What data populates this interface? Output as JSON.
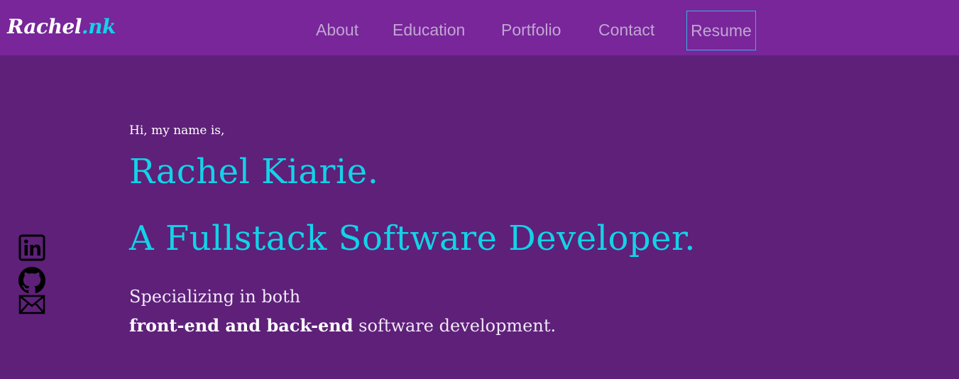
{
  "logo": {
    "main": "Rachel",
    "accent": ".nk"
  },
  "nav": {
    "items": [
      {
        "label": "About"
      },
      {
        "label": "Education"
      },
      {
        "label": "Portfolio"
      },
      {
        "label": "Contact"
      }
    ],
    "resume_label": "Resume"
  },
  "social": {
    "icons": [
      "linkedin-icon",
      "github-icon",
      "mail-icon"
    ]
  },
  "hero": {
    "greeting": "Hi, my name is,",
    "name": "Rachel Kiarie.",
    "role": "A Fullstack Software Developer.",
    "desc_line1": "Specializing in both",
    "desc_line2_strong": "front-end and back-end",
    "desc_line2_rest": " software development."
  },
  "colors": {
    "page_bg": "#5e2079",
    "nav_bg": "#78269a",
    "accent": "#12d3e8",
    "nav_text": "#c2a5d3",
    "resume_border": "#35b3e4"
  }
}
